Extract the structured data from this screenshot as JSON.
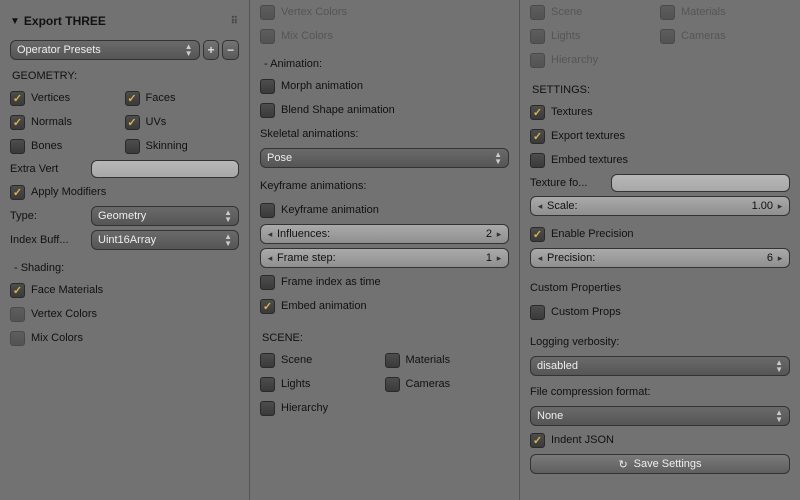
{
  "panel": {
    "title": "Export THREE"
  },
  "presets": {
    "label": "Operator Presets"
  },
  "geometry": {
    "heading": "GEOMETRY:",
    "vertices": "Vertices",
    "faces": "Faces",
    "normals": "Normals",
    "uvs": "UVs",
    "bones": "Bones",
    "skinning": "Skinning",
    "extra_vert_label": "Extra Vert",
    "apply_modifiers": "Apply Modifiers",
    "type_label": "Type:",
    "type_value": "Geometry",
    "index_label": "Index Buff...",
    "index_value": "Uint16Array"
  },
  "shading": {
    "heading": "- Shading:",
    "face_materials": "Face Materials",
    "vertex_colors": "Vertex Colors",
    "mix_colors": "Mix Colors"
  },
  "col2top": {
    "vertex_colors": "Vertex Colors",
    "mix_colors": "Mix Colors"
  },
  "animation": {
    "heading": "- Animation:",
    "morph": "Morph animation",
    "blend": "Blend Shape animation",
    "skeletal_label": "Skeletal animations:",
    "skeletal_value": "Pose",
    "keyframe_label": "Keyframe animations:",
    "keyframe_anim": "Keyframe animation",
    "influences_label": "Influences:",
    "influences_value": "2",
    "framestep_label": "Frame step:",
    "framestep_value": "1",
    "frame_index": "Frame index as time",
    "embed": "Embed animation"
  },
  "scene": {
    "heading": "SCENE:",
    "scene": "Scene",
    "materials": "Materials",
    "lights": "Lights",
    "cameras": "Cameras",
    "hierarchy": "Hierarchy"
  },
  "settings": {
    "heading": "SETTINGS:",
    "textures": "Textures",
    "export_textures": "Export textures",
    "embed_textures": "Embed textures",
    "texture_folder_label": "Texture fo...",
    "scale_label": "Scale:",
    "scale_value": "1.00",
    "enable_precision": "Enable Precision",
    "precision_label": "Precision:",
    "precision_value": "6",
    "custom_heading": "Custom Properties",
    "custom_props": "Custom Props",
    "logging_label": "Logging verbosity:",
    "logging_value": "disabled",
    "compression_label": "File compression format:",
    "compression_value": "None",
    "indent_json": "Indent JSON",
    "save_button": "Save Settings"
  }
}
